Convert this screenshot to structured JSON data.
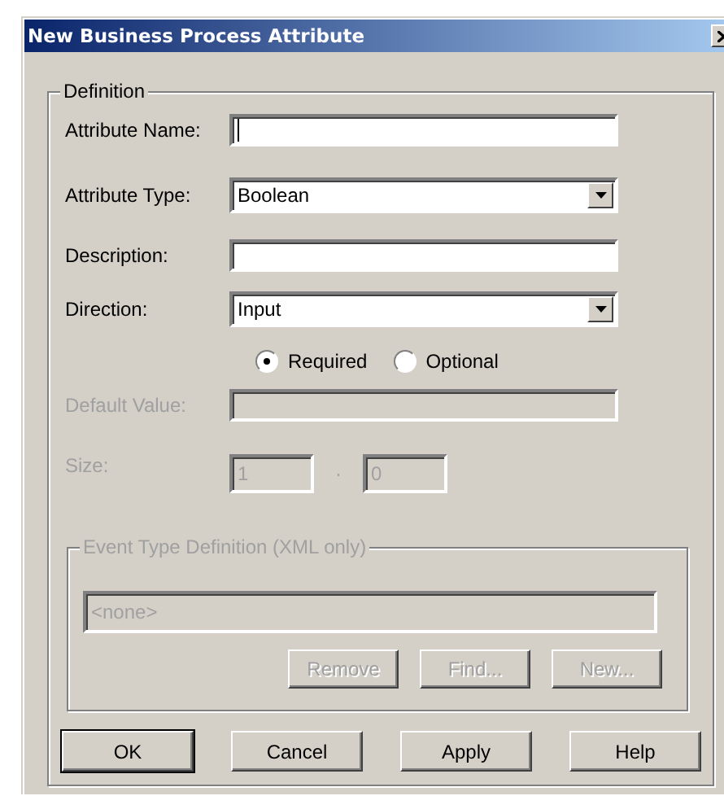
{
  "window": {
    "title": "New Business Process Attribute"
  },
  "definition": {
    "legend": "Definition",
    "fields": [
      {
        "kind": "text",
        "label": "Attribute Name:",
        "focused": true,
        "disabled": false
      },
      {
        "kind": "dropdown",
        "label": "Attribute Type:",
        "value": "Boolean",
        "disabled": false
      },
      {
        "kind": "text",
        "label": "Description:",
        "focused": false,
        "disabled": false
      },
      {
        "kind": "dropdown",
        "label": "Direction:",
        "value": "Input",
        "disabled": false
      },
      {
        "kind": "radios",
        "options": [
          {
            "label": "Required",
            "selected": true
          },
          {
            "label": "Optional",
            "selected": false
          }
        ]
      },
      {
        "kind": "text",
        "label": "Default Value:",
        "focused": false,
        "disabled": true
      },
      {
        "kind": "pair",
        "label": "Size:",
        "values": [
          "1",
          "0"
        ],
        "separator": "·",
        "disabled": true
      }
    ],
    "event_type": {
      "legend": "Event Type Definition (XML only)",
      "value": "<none>",
      "disabled": true,
      "buttons": [
        {
          "label": "Remove",
          "disabled": true
        },
        {
          "label": "Find...",
          "disabled": true
        },
        {
          "label": "New...",
          "disabled": true
        }
      ]
    }
  },
  "buttons": [
    {
      "label": "OK",
      "default": true
    },
    {
      "label": "Cancel",
      "default": false
    },
    {
      "label": "Apply",
      "default": false
    },
    {
      "label": "Help",
      "default": false
    }
  ]
}
